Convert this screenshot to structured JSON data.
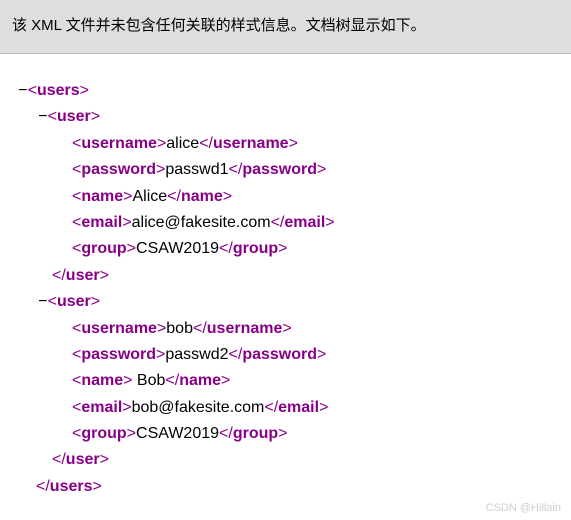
{
  "banner": {
    "text": "该 XML 文件并未包含任何关联的样式信息。文档树显示如下。"
  },
  "tags": {
    "users": "users",
    "user": "user",
    "username": "username",
    "password": "password",
    "name": "name",
    "email": "email",
    "group": "group"
  },
  "u1": {
    "username": "alice",
    "password": "passwd1",
    "name": "Alice",
    "email": "alice@fakesite.com",
    "group": "CSAW2019"
  },
  "u2": {
    "username": "bob",
    "password": "passwd2",
    "name": " Bob",
    "email": "bob@fakesite.com",
    "group": "CSAW2019"
  },
  "glyph": {
    "minus": "−",
    "lt": "<",
    "gt": ">",
    "slash": "/"
  },
  "watermark": "CSDN @Hillain"
}
